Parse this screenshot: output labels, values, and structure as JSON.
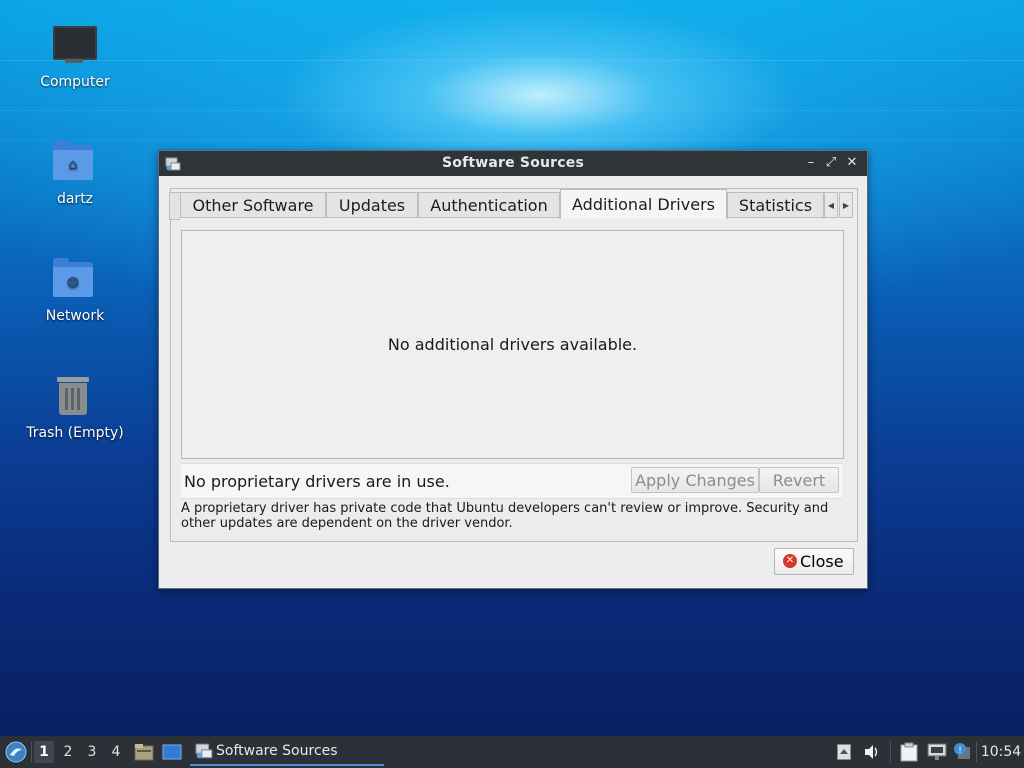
{
  "desktop": {
    "icons": [
      {
        "label": "Computer"
      },
      {
        "label": "dartz"
      },
      {
        "label": "Network"
      },
      {
        "label": "Trash (Empty)"
      }
    ]
  },
  "window": {
    "title": "Software Sources",
    "controls": {
      "minimize": "–",
      "maximize": "⤢",
      "close": "✕"
    },
    "tabs": [
      {
        "label": "Other Software",
        "active": false
      },
      {
        "label": "Updates",
        "active": false
      },
      {
        "label": "Authentication",
        "active": false
      },
      {
        "label": "Additional Drivers",
        "active": true
      },
      {
        "label": "Statistics",
        "active": false
      }
    ],
    "drivers": {
      "empty_message": "No additional drivers available.",
      "status_text": "No proprietary drivers are in use.",
      "apply_label": "Apply Changes",
      "revert_label": "Revert",
      "note": "A proprietary driver has private code that Ubuntu developers can't review or improve. Security and other updates are dependent on the driver vendor."
    },
    "close_label": "Close"
  },
  "taskbar": {
    "workspaces": [
      "1",
      "2",
      "3",
      "4"
    ],
    "active_workspace": "1",
    "task_label": "Software Sources",
    "clock": "10:54"
  },
  "colors": {
    "accent": "#4a90d9",
    "titlebar": "#2f3438",
    "taskbar": "#2b3136",
    "close_icon": "#d9362d"
  }
}
